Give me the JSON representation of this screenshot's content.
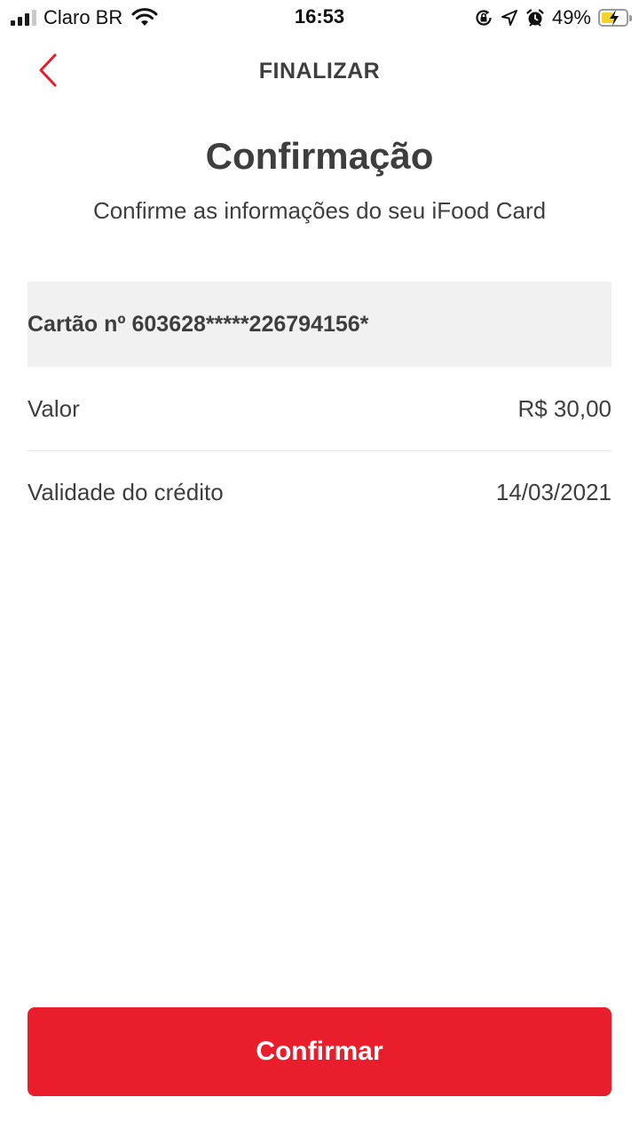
{
  "status_bar": {
    "carrier": "Claro BR",
    "time": "16:53",
    "battery_percent": "49%",
    "battery_level": 0.49,
    "signal_bars_active": 3,
    "signal_bars_total": 4,
    "icons": [
      "wifi-icon",
      "orientation-lock-icon",
      "location-arrow-icon",
      "alarm-icon",
      "battery-charging-icon"
    ]
  },
  "header": {
    "title": "FINALIZAR",
    "back_icon": "chevron-left-icon",
    "accent_color": "#ea1d2c"
  },
  "main": {
    "title": "Confirmação",
    "subtitle": "Confirme as informações do seu iFood Card",
    "card_label": "Cartão nº 603628*****226794156*",
    "rows": [
      {
        "label": "Valor",
        "value": "R$ 30,00"
      },
      {
        "label": "Validade do crédito",
        "value": "14/03/2021"
      }
    ]
  },
  "footer": {
    "confirm_label": "Confirmar",
    "button_color": "#ea1d2c"
  }
}
